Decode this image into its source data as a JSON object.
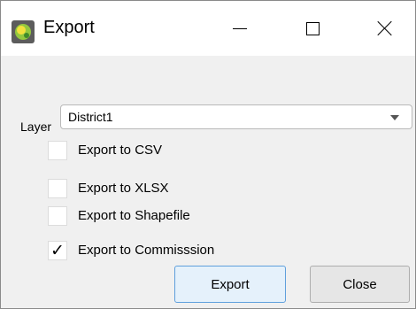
{
  "window": {
    "title": "Export",
    "app_icon": "qgis-logo-icon",
    "controls": [
      "minimize-icon",
      "maximize-icon",
      "close-icon"
    ]
  },
  "form": {
    "layer_label": "Layer",
    "layer_value": "District1",
    "options": [
      {
        "label": "Export to CSV",
        "checked": false
      },
      {
        "label": "Export to XLSX",
        "checked": false
      },
      {
        "label": "Export to Shapefile",
        "checked": false
      },
      {
        "label": "Export to Commisssion",
        "checked": true
      }
    ]
  },
  "buttons": {
    "export": "Export",
    "close": "Close"
  },
  "colors": {
    "window_bg": "#f0f0f0",
    "titlebar_bg": "#ffffff",
    "focus_border": "#5e9fdc"
  }
}
